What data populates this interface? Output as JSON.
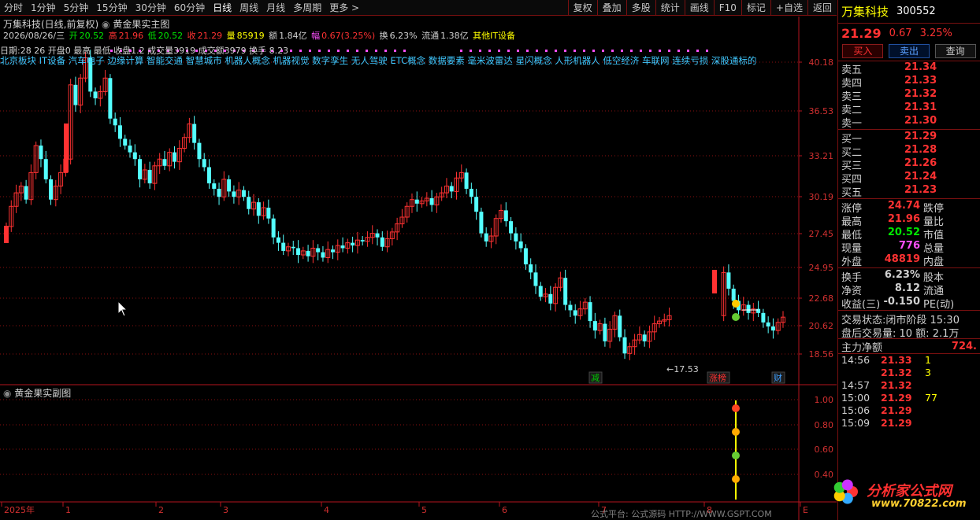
{
  "toolbar": {
    "periods": [
      "分时",
      "1分钟",
      "5分钟",
      "15分钟",
      "30分钟",
      "60分钟",
      "日线",
      "周线",
      "月线",
      "多周期",
      "更多 >"
    ],
    "active_period": "日线",
    "buttons": [
      "复权",
      "叠加",
      "多股",
      "统计",
      "画线",
      "F10",
      "标记",
      "+自选",
      "返回"
    ]
  },
  "chart": {
    "title": "万集科技(日线,前复权)",
    "indicator_name": "黄金果实主图",
    "ohlc": {
      "date": "2026/08/26/三",
      "open_label": "开",
      "open": "20.52",
      "high_label": "高",
      "high": "21.96",
      "low_label": "低",
      "low": "20.52",
      "close_label": "收",
      "close": "21.29",
      "vol_label": "量",
      "vol": "85919",
      "amt_label": "额",
      "amt": "1.84亿",
      "chg_label": "幅",
      "chg": "0.67(3.25%)",
      "turnover_label": "换",
      "turnover": "6.23%",
      "float_label": "流通",
      "float": "1.38亿",
      "sector": "其他IT设备"
    },
    "info_line": "日期:28  26  开盘0  最高  最低  收盘1.2  成交量3919  成交额3979  换手  8.23",
    "concepts": "北京板块 IT设备 汽车电子 边缘计算 智能交通 智慧城市 机器人概念 机器视觉 数字孪生 无人驾驶 ETC概念 数据要素 毫米波雷达 星闪概念 人形机器人 低空经济 车联网 连续亏损 深股通标的",
    "y_ticks": [
      "40.18",
      "36.53",
      "33.21",
      "30.19",
      "27.45",
      "24.95",
      "22.68",
      "20.62",
      "18.56"
    ],
    "low_marker": "17.53",
    "event_tags": [
      "减",
      "涨榜",
      "财"
    ],
    "sub_title": "黄金果实副图",
    "sub_y_ticks": [
      "1.00",
      "0.80",
      "0.60",
      "0.40"
    ],
    "x_ticks": [
      "2025年",
      "1",
      "2",
      "3",
      "4",
      "5",
      "6",
      "7",
      "8",
      "E"
    ],
    "colors": {
      "up": "#ff3232",
      "down": "#54ffff",
      "grid": "#8a1010",
      "axis": "#b4141e"
    }
  },
  "quote": {
    "name": "万集科技",
    "code": "300552",
    "price": "21.29",
    "change": "0.67",
    "change_pct": "3.25%",
    "buy_label": "买入",
    "sell_label": "卖出",
    "query_label": "查询",
    "asks": [
      {
        "label": "卖五",
        "price": "21.34",
        "vol": ""
      },
      {
        "label": "卖四",
        "price": "21.33",
        "vol": ""
      },
      {
        "label": "卖三",
        "price": "21.32",
        "vol": ""
      },
      {
        "label": "卖二",
        "price": "21.31",
        "vol": ""
      },
      {
        "label": "卖一",
        "price": "21.30",
        "vol": ""
      }
    ],
    "bids": [
      {
        "label": "买一",
        "price": "21.29",
        "vol": ""
      },
      {
        "label": "买二",
        "price": "21.28",
        "vol": ""
      },
      {
        "label": "买三",
        "price": "21.26",
        "vol": ""
      },
      {
        "label": "买四",
        "price": "21.24",
        "vol": ""
      },
      {
        "label": "买五",
        "price": "21.23",
        "vol": ""
      }
    ],
    "stats1": [
      {
        "l": "涨停",
        "v": "24.74",
        "c": "#ff3232",
        "r": "跌停"
      },
      {
        "l": "最高",
        "v": "21.96",
        "c": "#ff3232",
        "r": "量比"
      },
      {
        "l": "最低",
        "v": "20.52",
        "c": "#00e600",
        "r": "市值"
      },
      {
        "l": "现量",
        "v": "776",
        "c": "#ff50ff",
        "r": "总量"
      },
      {
        "l": "外盘",
        "v": "48819",
        "c": "#ff3232",
        "r": "内盘"
      }
    ],
    "stats2": [
      {
        "l": "换手",
        "v": "6.23%",
        "c": "#d0d0d0",
        "r": "股本"
      },
      {
        "l": "净资",
        "v": "8.12",
        "c": "#d0d0d0",
        "r": "流通"
      },
      {
        "l": "收益(三)",
        "v": "-0.150",
        "c": "#d0d0d0",
        "r": "PE(动)"
      }
    ],
    "trade_status": "交易状态:闭市阶段 15:30",
    "after_hours": "盘后交易量: 10  额: 2.1万",
    "mainflow_label": "主力净额",
    "mainflow_value": "724.",
    "ticks": [
      {
        "t": "14:56",
        "p": "21.33",
        "v": "1"
      },
      {
        "t": "",
        "p": "21.32",
        "v": "3"
      },
      {
        "t": "14:57",
        "p": "21.32",
        "v": ""
      },
      {
        "t": "15:00",
        "p": "21.29",
        "v": "77"
      },
      {
        "t": "15:06",
        "p": "21.29",
        "v": ""
      },
      {
        "t": "15:09",
        "p": "21.29",
        "v": ""
      }
    ]
  },
  "watermark": {
    "site_name": "分析家公式网",
    "site_url": "www.70822.com",
    "footer": "公式平台: 公式源码 HTTP://WWW.GSPT.COM"
  }
}
